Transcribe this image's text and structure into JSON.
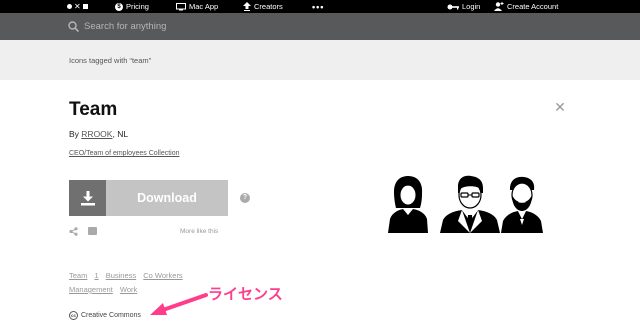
{
  "nav": {
    "pricing": "Pricing",
    "mac_app": "Mac App",
    "creators": "Creators",
    "more": "•••",
    "login": "Login",
    "create_account": "Create Account"
  },
  "search": {
    "placeholder": "Search for anything"
  },
  "tag_heading": "Icons tagged with “team”",
  "icon": {
    "title": "Team",
    "by_prefix": "By",
    "author": "RROOK",
    "location": ", NL",
    "collection": "CEO/Team of employees Collection"
  },
  "actions": {
    "download_label": "Download",
    "help": "?",
    "more_like_this": "More like this"
  },
  "tags_row1": [
    "Team",
    "1",
    "Business",
    "Co Workers"
  ],
  "tags_row2": [
    "Management",
    "Work"
  ],
  "license": {
    "cc_badge": "cc",
    "label": "Creative Commons"
  },
  "annotation": {
    "text": "ライセンス",
    "color": "#ff3d8b"
  },
  "colors": {
    "nav_bg": "#000000",
    "search_bg": "#58595b",
    "strip_bg": "#efefef",
    "download_bg": "#c4c4c4",
    "download_icon_bg": "#707070"
  }
}
